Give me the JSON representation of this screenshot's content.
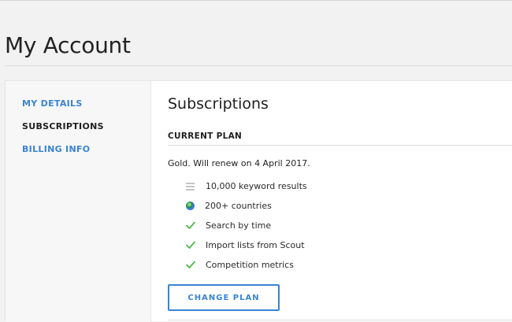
{
  "page": {
    "title": "My Account"
  },
  "sidebar": {
    "items": [
      {
        "label": "MY DETAILS",
        "active": false
      },
      {
        "label": "SUBSCRIPTIONS",
        "active": true
      },
      {
        "label": "BILLING INFO",
        "active": false
      }
    ]
  },
  "main": {
    "section_title": "Subscriptions",
    "current_plan_heading": "CURRENT PLAN",
    "plan_description": "Gold. Will renew on 4 April 2017.",
    "features": [
      {
        "icon": "list-bars-icon",
        "label": "10,000 keyword results"
      },
      {
        "icon": "globe-icon",
        "label": "200+ countries"
      },
      {
        "icon": "check-icon",
        "label": "Search by time"
      },
      {
        "icon": "check-icon",
        "label": "Import lists from Scout"
      },
      {
        "icon": "check-icon",
        "label": "Competition metrics"
      }
    ],
    "change_plan_label": "CHANGE PLAN"
  },
  "colors": {
    "accent": "#3a84d4",
    "check": "#4cbb4c",
    "background": "#f2f2f2"
  }
}
